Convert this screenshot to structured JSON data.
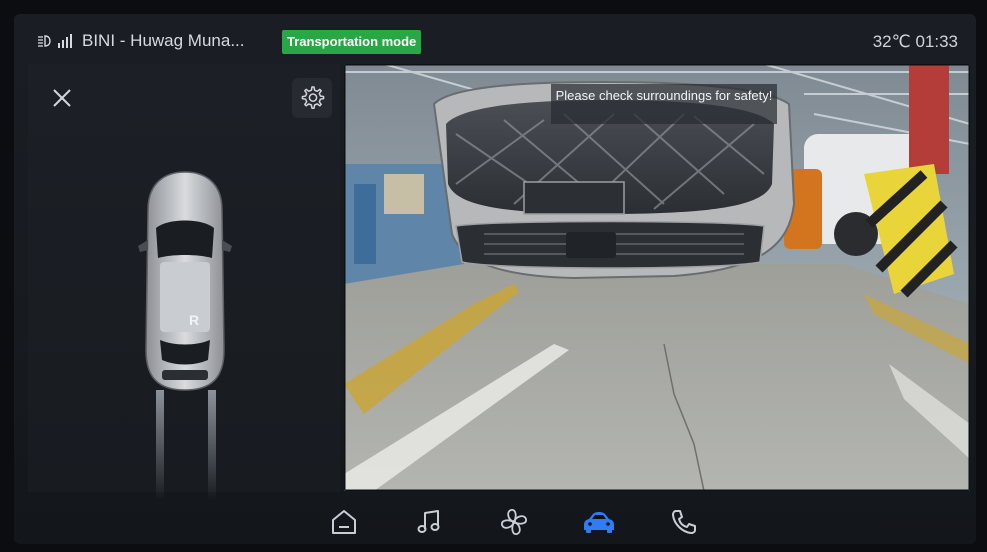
{
  "status_bar": {
    "song_title": "BINI - Huwag Muna...",
    "mode_badge": "Transportation mode",
    "temperature": "32℃",
    "time": "01:33",
    "icons": [
      "headlight-icon",
      "signal-icon"
    ]
  },
  "parking_panel": {
    "gear_label": "R",
    "icons": [
      "close-icon",
      "gear-icon",
      "car-top-view-icon"
    ]
  },
  "camera": {
    "warning_text": "Please check surroundings for safety!"
  },
  "bottom_nav": {
    "items": [
      {
        "name": "home",
        "icon": "home-icon",
        "active": false
      },
      {
        "name": "music",
        "icon": "music-note-icon",
        "active": false
      },
      {
        "name": "climate",
        "icon": "fan-icon",
        "active": false
      },
      {
        "name": "vehicle",
        "icon": "car-icon",
        "active": true
      },
      {
        "name": "phone",
        "icon": "phone-icon",
        "active": false
      }
    ],
    "active_color": "#2f7cf6",
    "inactive_color": "#c9ced6"
  },
  "colors": {
    "badge": "#28a745",
    "background": "#171b20"
  }
}
